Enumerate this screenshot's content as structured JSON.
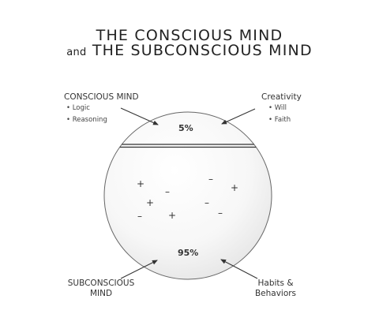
{
  "title": {
    "line1": "THE CONSCIOUS MIND",
    "line2_prefix": "and",
    "line2_main": "THE SUBCONSCIOUS MIND"
  },
  "conscious": {
    "label": "CONSCIOUS MIND",
    "items": [
      "• Logic",
      "• Reasoning"
    ],
    "percent": "5%"
  },
  "creativity": {
    "label": "Creativity",
    "items": [
      "• Will",
      "• Faith"
    ]
  },
  "subconscious": {
    "label_line1": "SUBCONSCIOUS",
    "label_line2": "MIND",
    "percent": "95%"
  },
  "habits": {
    "label_line1": "Habits &",
    "label_line2": "Behaviors"
  },
  "symbols": {
    "plus": "+",
    "minus": "–"
  }
}
